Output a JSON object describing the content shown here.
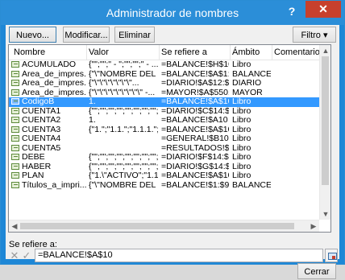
{
  "window": {
    "title": "Administrador de nombres",
    "help_label": "?",
    "close_label": "✕"
  },
  "toolbar": {
    "new_label": "Nuevo...",
    "edit_label": "Modificar...",
    "delete_label": "Eliminar",
    "filter_label": "Filtro ▾"
  },
  "columns": {
    "name": "Nombre",
    "value": "Valor",
    "refers": "Se refiere a",
    "scope": "Ámbito",
    "comment": "Comentario"
  },
  "rows": [
    {
      "name": "ACUMULADO",
      "value": "{\"\";\"\";\" -   \";\"\";\"\";\" - ...",
      "refers": "=BALANCE!$H$10:$...",
      "scope": "Libro",
      "selected": false
    },
    {
      "name": "Área_de_impres...",
      "value": "{\"\\\"NOMBRE DEL N...",
      "refers": "=BALANCE!$A$1:$F...",
      "scope": "BALANCE",
      "selected": false
    },
    {
      "name": "Área_de_impres...",
      "value": "{\"\\\"\\\"\\\"\\\"\\\"\\\"\\\"...",
      "refers": "=DIARIO!$A$12:$G...",
      "scope": "DIARIO",
      "selected": false
    },
    {
      "name": "Área_de_impres...",
      "value": "{\"\\\"\\\"\\\"\\\"\\\"\\\"\\\"\\\"\\\" -...",
      "refers": "=MAYOR!$A$5501:...",
      "scope": "MAYOR",
      "selected": false
    },
    {
      "name": "CodigoB",
      "value": "1.",
      "refers": "=BALANCE!$A$10",
      "scope": "Libro",
      "selected": true
    },
    {
      "name": "CUENTA1",
      "value": "{\"\";\"\";\"\";\"\";\"\";\"\";\"\";\"\";\"\";\"\";...",
      "refers": "=DIARIO!$C$14:$C...",
      "scope": "Libro",
      "selected": false
    },
    {
      "name": "CUENTA2",
      "value": "1.",
      "refers": "=BALANCE!$A10",
      "scope": "Libro",
      "selected": false
    },
    {
      "name": "CUENTA3",
      "value": "{\"1.\";\"1.1.\";\"1.1.1.\";\"...",
      "refers": "=BALANCE!$A$10:$...",
      "scope": "Libro",
      "selected": false
    },
    {
      "name": "CUENTA4",
      "value": "",
      "refers": "=GENERAL!$B10",
      "scope": "Libro",
      "selected": false
    },
    {
      "name": "CUENTA5",
      "value": "",
      "refers": "=RESULTADOS!$B10",
      "scope": "Libro",
      "selected": false
    },
    {
      "name": "DEBE",
      "value": "{\"\";\"\";\"\";\"\";\"\";\"\";\"\";\"\";\"\";\"\";...",
      "refers": "=DIARIO!$F$14:$F$...",
      "scope": "Libro",
      "selected": false
    },
    {
      "name": "HABER",
      "value": "{\"\";\"\";\"\";\"\";\"\";\"\";\"\";\"\";\"\";\"\";...",
      "refers": "=DIARIO!$G$14:$G...",
      "scope": "Libro",
      "selected": false
    },
    {
      "name": "PLAN",
      "value": "{\"1.\\\"ACTIVO\";\"1.1.\\\"...",
      "refers": "=BALANCE!$A$10:$...",
      "scope": "Libro",
      "selected": false
    },
    {
      "name": "Títulos_a_impri...",
      "value": "{\"\\\"NOMBRE DEL N...",
      "refers": "=BALANCE!$1:$9",
      "scope": "BALANCE",
      "selected": false
    }
  ],
  "refers_section": {
    "label": "Se refiere a:",
    "value": "=BALANCE!$A$10",
    "cancel_icon": "x-icon",
    "accept_icon": "check-icon"
  },
  "footer": {
    "close_label": "Cerrar"
  }
}
